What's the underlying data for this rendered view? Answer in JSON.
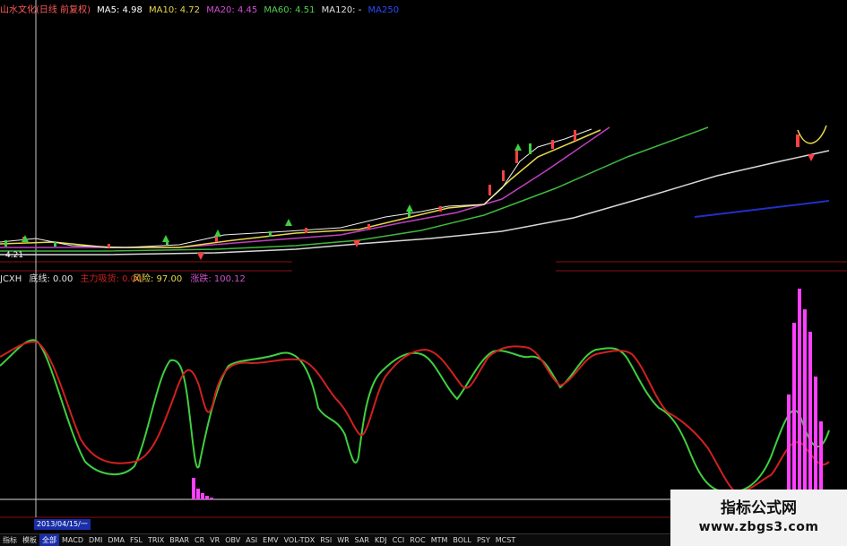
{
  "header": {
    "stock_name": "山水文化(日线 前复权)",
    "ma5": "MA5: 4.98",
    "ma10": "MA10: 4.72",
    "ma20": "MA20: 4.45",
    "ma60": "MA60: 4.51",
    "ma120": "MA120: -",
    "ma250": "MA250"
  },
  "indicator_header": {
    "name": "JCXH",
    "baseline": "底线: 0.00",
    "main_force": "主力吸货: 0.00",
    "risk": "风险: 97.00",
    "rise": "涨跌: 100.12"
  },
  "price_labels": {
    "left_low": "4.21"
  },
  "date_bar": {
    "cursor_date": "2013/04/15/一"
  },
  "tabs": [
    "指标",
    "模板",
    "全部",
    "MACD",
    "DMI",
    "DMA",
    "FSL",
    "TRIX",
    "BRAR",
    "CR",
    "VR",
    "OBV",
    "ASI",
    "EMV",
    "VOL-TDX",
    "RSI",
    "WR",
    "SAR",
    "KDJ",
    "CCI",
    "ROC",
    "MTM",
    "BOLL",
    "PSY",
    "MCST"
  ],
  "active_tab_index": 2,
  "watermark": {
    "title": "指标公式网",
    "url": "www.zbgs3.com"
  },
  "colors": {
    "ma5": "#e0e0e0",
    "ma10": "#e8d84a",
    "ma20": "#c040c0",
    "ma60": "#3fb83f",
    "ma120": "#d8d8d8",
    "ma250": "#2030c8",
    "indicator_green": "#3fcf3f",
    "indicator_red": "#d02020",
    "bars": "#ff40ff",
    "grid_red": "#8a1010"
  }
}
